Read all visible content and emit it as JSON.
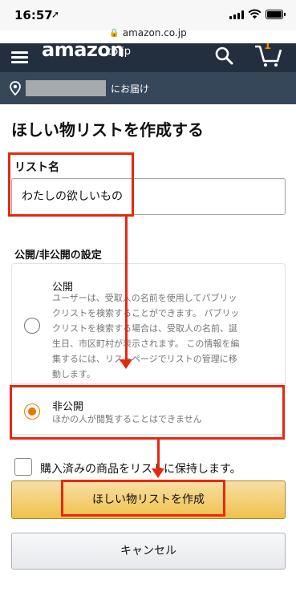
{
  "status": {
    "time": "16:57"
  },
  "browser": {
    "url": "amazon.co.jp"
  },
  "header": {
    "logo": "amazon",
    "logo_suffix": ".co.jp",
    "cart_count": "1"
  },
  "delivery": {
    "text": "にお届け"
  },
  "page": {
    "title": "ほしい物リストを作成する",
    "list_name_label": "リスト名",
    "list_name_value": "わたしの欲しいもの",
    "privacy_label": "公開/非公開の設定",
    "options": [
      {
        "title": "公開",
        "desc_lines": [
          "ユーザーは、受取人の名前を使用してパブリッ",
          "クリストを検索することができます。 パブリッ",
          "クリストを検索する場合は、受取人の名前、誕",
          "生日、市区町村が表示されます。 この情報を編",
          "集するには、リストページでリストの管理に移",
          "動します。"
        ],
        "selected": false
      },
      {
        "title": "非公開",
        "desc_lines": [
          "ほかの人が閲覧することはできません"
        ],
        "selected": true
      }
    ],
    "keep_purchased_label": "購入済みの商品をリストに保持します。",
    "create_button": "ほしい物リストを作成",
    "cancel_button": "キャンセル"
  },
  "colors": {
    "header_bg": "#232f3e",
    "delivery_bg": "#37475a",
    "annotation_red": "#e8280f",
    "radio_selected": "#e77600",
    "primary_button": "#f0c14b"
  }
}
